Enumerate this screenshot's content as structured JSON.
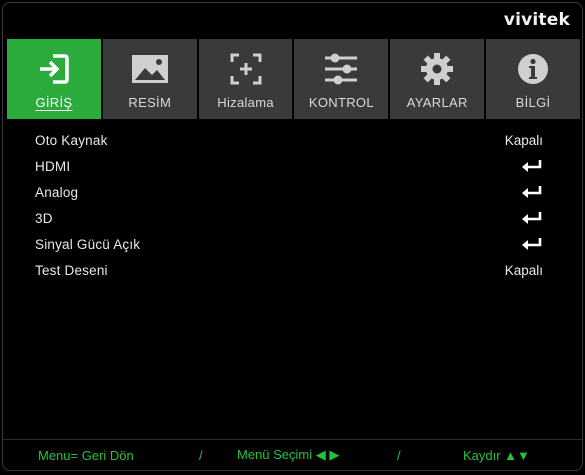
{
  "brand": "vivitek",
  "tabs": [
    {
      "label": "GİRİŞ",
      "icon": "input-icon",
      "active": true
    },
    {
      "label": "RESİM",
      "icon": "picture-icon",
      "active": false
    },
    {
      "label": "Hizalama",
      "icon": "alignment-icon",
      "active": false
    },
    {
      "label": "KONTROL",
      "icon": "sliders-icon",
      "active": false
    },
    {
      "label": "AYARLAR",
      "icon": "gear-icon",
      "active": false
    },
    {
      "label": "BİLGİ",
      "icon": "info-icon",
      "active": false
    }
  ],
  "rows": [
    {
      "name": "Oto Kaynak",
      "value": "Kapalı",
      "type": "text"
    },
    {
      "name": "HDMI",
      "value": "",
      "type": "enter"
    },
    {
      "name": "Analog",
      "value": "",
      "type": "enter"
    },
    {
      "name": "3D",
      "value": "",
      "type": "enter"
    },
    {
      "name": "Sinyal Gücü Açık",
      "value": "",
      "type": "enter"
    },
    {
      "name": "Test Deseni",
      "value": "Kapalı",
      "type": "text"
    }
  ],
  "footer": {
    "back": "Menu= Geri Dön",
    "sep1": "/",
    "select": "Menü Seçimi ◀ ▶",
    "sep2": "/",
    "scroll": "Kaydır ▲▼"
  },
  "colors": {
    "accent": "#2aab3c",
    "tab_bg": "#3a3a3a",
    "footer_text": "#27c23c"
  }
}
